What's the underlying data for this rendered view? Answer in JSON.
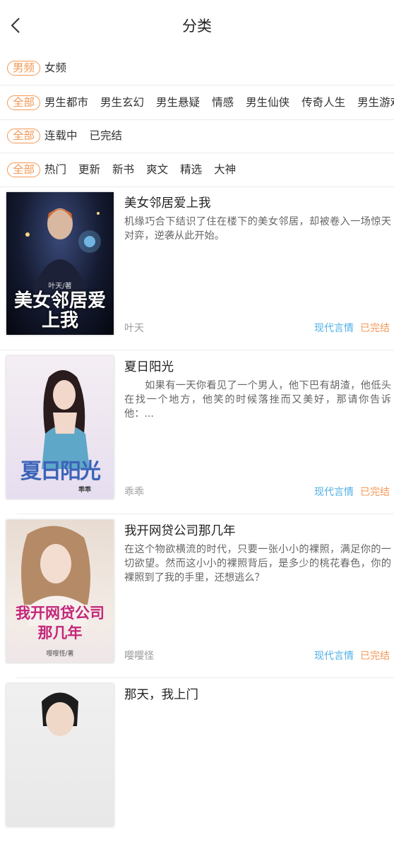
{
  "header": {
    "title": "分类"
  },
  "filters": {
    "gender": {
      "selected": "男频",
      "options": [
        "女频"
      ]
    },
    "category": {
      "selected": "全部",
      "options": [
        "男生都市",
        "男生玄幻",
        "男生悬疑",
        "情感",
        "男生仙侠",
        "传奇人生",
        "男生游戏"
      ]
    },
    "status": {
      "selected": "全部",
      "options": [
        "连载中",
        "已完结"
      ]
    },
    "sort": {
      "selected": "全部",
      "options": [
        "热门",
        "更新",
        "新书",
        "爽文",
        "精选",
        "大神"
      ]
    }
  },
  "books": [
    {
      "title": "美女邻居爱上我",
      "desc": "机缘巧合下结识了住在楼下的美女邻居，却被卷入一场惊天对弈，逆袭从此开始。",
      "author": "叶天",
      "genre": "现代言情",
      "status": "已完结",
      "cover_title": "美女邻居爱上我",
      "cover_author": "叶天/著"
    },
    {
      "title": "夏日阳光",
      "desc": "　　如果有一天你看见了一个男人，他下巴有胡渣，他低头在找一个地方，他笑的时候落挫而又美好，那请你告诉他：...",
      "author": "乖乖",
      "genre": "现代言情",
      "status": "已完结",
      "cover_title": "夏日阳光",
      "cover_author": "乖乖"
    },
    {
      "title": "我开网贷公司那几年",
      "desc": "在这个物欲横流的时代，只要一张小小的裸照，满足你的一切欲望。然而这小小的裸照背后，是多少的桃花春色，你的裸照到了我的手里，还想逃么？",
      "author": "嘤嘤怪",
      "genre": "现代言情",
      "status": "已完结",
      "cover_title": "我开网贷公司那几年",
      "cover_author": "嘤嘤怪/著"
    },
    {
      "title": "那天，我上门",
      "desc": "",
      "author": "",
      "genre": "",
      "status": ""
    }
  ],
  "colors": {
    "accent": "#f39855",
    "genre": "#4fb0e6"
  }
}
